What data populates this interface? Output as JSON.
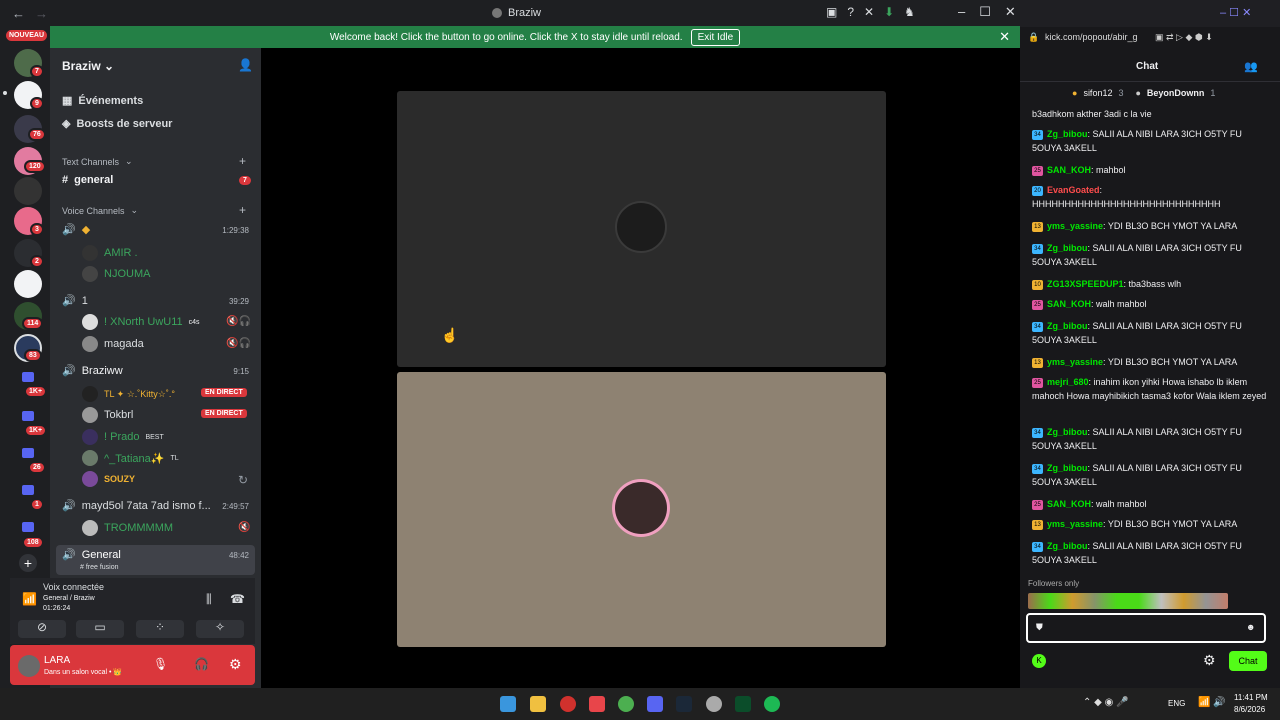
{
  "titlebar": {
    "title": "Braziw",
    "back": "←",
    "forward": "→"
  },
  "banner": {
    "message": "Welcome back! Click the button to go online. Click the X to stay idle until reload.",
    "button": "Exit Idle",
    "close": "✕"
  },
  "rail": {
    "new_label": "NOUVEAU",
    "badges": [
      "7",
      "9",
      "76",
      "120",
      "3",
      "2",
      "114",
      "83",
      "1K+",
      "1K+",
      "26",
      "1",
      "108"
    ]
  },
  "server": {
    "name": "Braziw",
    "events": "Événements",
    "boosts": "Boosts de serveur",
    "text_category": "Text Channels",
    "general_channel": "general",
    "general_badge": "7",
    "voice_category": "Voice Channels",
    "voice": [
      {
        "name": "",
        "time": "1:29:38",
        "members": [
          "AMIR .",
          "NJOUMA"
        ]
      },
      {
        "name": "1",
        "time": "39:29",
        "members": [
          "! XNorth UwU11",
          "magada"
        ],
        "member_tag": "c4s"
      },
      {
        "name": "Braziww",
        "time": "9:15",
        "members": [
          "TL ✦ ☆.˚Kitty☆˚.°",
          "Tokbrl",
          "! Prado",
          "^_Tatiana✨",
          "SOUZY"
        ],
        "tags": [
          "EN DIRECT",
          "EN DIRECT",
          "BEST",
          "TL"
        ]
      },
      {
        "name": "mayd5ol 7ata 7ad ismo f...",
        "time": "2:49:57",
        "members": [
          "TROMMMMM"
        ]
      },
      {
        "name": "General",
        "time": "48:42",
        "sub": "# free fusion"
      }
    ]
  },
  "voice_panel": {
    "status": "Voix connectée",
    "location": "General / Braziw",
    "duration": "01:26:24"
  },
  "user": {
    "name": "LARA",
    "status": "Dans un salon vocal • 👑"
  },
  "chat": {
    "url": "kick.com/popout/abir_g",
    "title": "Chat",
    "pinned": [
      {
        "name": "sifon12",
        "count": "3"
      },
      {
        "name": "BeyonDownn",
        "count": "1"
      }
    ],
    "messages": [
      {
        "user": "",
        "text": "b3adhkom akther 3adi c la vie",
        "color": "#efeff1",
        "lvl": ""
      },
      {
        "user": "Zg_bibou",
        "text": "SALII ALA NIBI LARA 3ICH O5TY FU 5OUYA 3AKELL",
        "color": "#00e701",
        "lvl": "34"
      },
      {
        "user": "SAN_KOH",
        "text": "mahbol",
        "color": "#00e701",
        "lvl": "25"
      },
      {
        "user": "EvanGoated",
        "text": "HHHHHHHHHHHHHHHHHHHHHHHHHHHHH",
        "color": "#ff4d4d",
        "lvl": "20"
      },
      {
        "user": "yms_yassine",
        "text": "YDI BL3O BCH YMOT YA LARA",
        "color": "#00e701",
        "lvl": "13"
      },
      {
        "user": "Zg_bibou",
        "text": "SALII ALA NIBI LARA 3ICH O5TY FU 5OUYA 3AKELL",
        "color": "#00e701",
        "lvl": "34"
      },
      {
        "user": "ZG13XSPEEDUP1",
        "text": "tba3bass wlh",
        "color": "#00e701",
        "lvl": "10"
      },
      {
        "user": "SAN_KOH",
        "text": "walh mahbol",
        "color": "#00e701",
        "lvl": "25"
      },
      {
        "user": "Zg_bibou",
        "text": "SALII ALA NIBI LARA 3ICH O5TY FU 5OUYA 3AKELL",
        "color": "#00e701",
        "lvl": "34"
      },
      {
        "user": "yms_yassine",
        "text": "YDI BL3O BCH YMOT YA LARA",
        "color": "#00e701",
        "lvl": "13"
      },
      {
        "user": "mejri_680",
        "text": "inahim ikon yihki Howa ishabo lb iklem mahoch Howa mayhibikich tasma3 kofor Wala iklem zeyed",
        "color": "#00e701",
        "lvl": "25"
      },
      {
        "user": "Zg_bibou",
        "text": "SALII ALA NIBI LARA 3ICH O5TY FU 5OUYA 3AKELL",
        "color": "#00e701",
        "lvl": "34"
      },
      {
        "user": "Zg_bibou",
        "text": "SALII ALA NIBI LARA 3ICH O5TY FU 5OUYA 3AKELL",
        "color": "#00e701",
        "lvl": "34"
      },
      {
        "user": "SAN_KOH",
        "text": "walh mahbol",
        "color": "#00e701",
        "lvl": "25"
      },
      {
        "user": "yms_yassine",
        "text": "YDI BL3O BCH YMOT YA LARA",
        "color": "#00e701",
        "lvl": "13"
      },
      {
        "user": "Zg_bibou",
        "text": "SALII ALA NIBI LARA 3ICH O5TY FU 5OUYA 3AKELL",
        "color": "#00e701",
        "lvl": "34"
      }
    ],
    "followers_only": "Followers only",
    "send_button": "Chat"
  },
  "taskbar": {
    "lang": "ENG",
    "time": "11:41 PM",
    "date": "8/6/2026"
  }
}
